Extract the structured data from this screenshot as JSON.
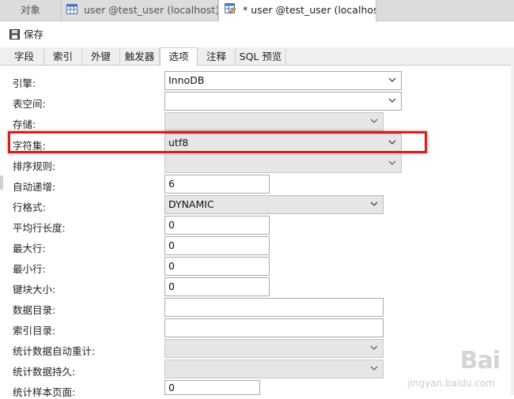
{
  "doc_tabs": [
    {
      "label": "对象"
    },
    {
      "label": "user @test_user (localhost)"
    },
    {
      "label": "* user @test_user (localhost..."
    }
  ],
  "toolbar": {
    "save_label": "保存"
  },
  "sub_tabs": [
    {
      "label": "字段"
    },
    {
      "label": "索引"
    },
    {
      "label": "外键"
    },
    {
      "label": "触发器"
    },
    {
      "label": "选项"
    },
    {
      "label": "注释"
    },
    {
      "label": "SQL 预览"
    }
  ],
  "active_sub_tab": "选项",
  "options": {
    "engine": {
      "label": "引擎:",
      "value": "InnoDB"
    },
    "tablespace": {
      "label": "表空间:",
      "value": ""
    },
    "storage": {
      "label": "存储:",
      "value": ""
    },
    "charset": {
      "label": "字符集:",
      "value": "utf8"
    },
    "collation": {
      "label": "排序规则:",
      "value": ""
    },
    "auto_increment": {
      "label": "自动递增:",
      "value": "6"
    },
    "row_format": {
      "label": "行格式:",
      "value": "DYNAMIC"
    },
    "avg_row_length": {
      "label": "平均行长度:",
      "value": "0"
    },
    "max_rows": {
      "label": "最大行:",
      "value": "0"
    },
    "min_rows": {
      "label": "最小行:",
      "value": "0"
    },
    "key_block_size": {
      "label": "键块大小:",
      "value": "0"
    },
    "data_directory": {
      "label": "数据目录:",
      "value": ""
    },
    "index_directory": {
      "label": "索引目录:",
      "value": ""
    },
    "stats_auto_recalc": {
      "label": "统计数据自动重计:",
      "value": ""
    },
    "stats_persistent": {
      "label": "统计数据持久:",
      "value": ""
    },
    "stats_sample_pages": {
      "label": "统计样本页面:",
      "value": "0"
    }
  },
  "watermark": {
    "text": "Bai",
    "sub": "jingyan.baidu.com"
  },
  "colors": {
    "highlight": "#d81e1e"
  }
}
